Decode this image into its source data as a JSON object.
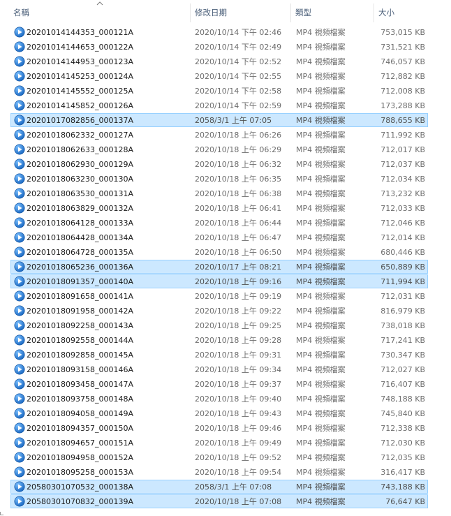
{
  "columns": {
    "name": "名稱",
    "modified": "修改日期",
    "type": "類型",
    "size": "大小"
  },
  "sort": {
    "column": "name",
    "direction": "ascending",
    "icon": "sort-up-chevron-icon"
  },
  "file_icon": "media-play-icon",
  "colors": {
    "selection_fill": "#cce8ff",
    "selection_border": "#99d1ff",
    "icon_blue": "#2f7fd6"
  },
  "files": [
    {
      "name": "20201014144353_000121A",
      "modified": "2020/10/14 下午 02:46",
      "type": "MP4 視頻檔案",
      "size": "753,015 KB",
      "selected": false
    },
    {
      "name": "20201014144653_000122A",
      "modified": "2020/10/14 下午 02:49",
      "type": "MP4 視頻檔案",
      "size": "731,521 KB",
      "selected": false
    },
    {
      "name": "20201014144953_000123A",
      "modified": "2020/10/14 下午 02:52",
      "type": "MP4 視頻檔案",
      "size": "746,057 KB",
      "selected": false
    },
    {
      "name": "20201014145253_000124A",
      "modified": "2020/10/14 下午 02:55",
      "type": "MP4 視頻檔案",
      "size": "712,882 KB",
      "selected": false
    },
    {
      "name": "20201014145552_000125A",
      "modified": "2020/10/14 下午 02:58",
      "type": "MP4 視頻檔案",
      "size": "712,008 KB",
      "selected": false
    },
    {
      "name": "20201014145852_000126A",
      "modified": "2020/10/14 下午 02:59",
      "type": "MP4 視頻檔案",
      "size": "173,288 KB",
      "selected": false
    },
    {
      "name": "20201017082856_000137A",
      "modified": "2058/3/1 上午 07:05",
      "type": "MP4 視頻檔案",
      "size": "788,655 KB",
      "selected": true
    },
    {
      "name": "20201018062332_000127A",
      "modified": "2020/10/18 上午 06:26",
      "type": "MP4 視頻檔案",
      "size": "711,992 KB",
      "selected": false
    },
    {
      "name": "20201018062633_000128A",
      "modified": "2020/10/18 上午 06:29",
      "type": "MP4 視頻檔案",
      "size": "712,017 KB",
      "selected": false
    },
    {
      "name": "20201018062930_000129A",
      "modified": "2020/10/18 上午 06:32",
      "type": "MP4 視頻檔案",
      "size": "712,037 KB",
      "selected": false
    },
    {
      "name": "20201018063230_000130A",
      "modified": "2020/10/18 上午 06:35",
      "type": "MP4 視頻檔案",
      "size": "712,034 KB",
      "selected": false
    },
    {
      "name": "20201018063530_000131A",
      "modified": "2020/10/18 上午 06:38",
      "type": "MP4 視頻檔案",
      "size": "713,232 KB",
      "selected": false
    },
    {
      "name": "20201018063829_000132A",
      "modified": "2020/10/18 上午 06:41",
      "type": "MP4 視頻檔案",
      "size": "712,033 KB",
      "selected": false
    },
    {
      "name": "20201018064128_000133A",
      "modified": "2020/10/18 上午 06:44",
      "type": "MP4 視頻檔案",
      "size": "712,046 KB",
      "selected": false
    },
    {
      "name": "20201018064428_000134A",
      "modified": "2020/10/18 上午 06:47",
      "type": "MP4 視頻檔案",
      "size": "712,014 KB",
      "selected": false
    },
    {
      "name": "20201018064728_000135A",
      "modified": "2020/10/18 上午 06:50",
      "type": "MP4 視頻檔案",
      "size": "680,446 KB",
      "selected": false
    },
    {
      "name": "20201018065236_000136A",
      "modified": "2020/10/17 上午 08:21",
      "type": "MP4 視頻檔案",
      "size": "650,889 KB",
      "selected": true
    },
    {
      "name": "20201018091357_000140A",
      "modified": "2020/10/18 上午 09:16",
      "type": "MP4 視頻檔案",
      "size": "711,994 KB",
      "selected": true
    },
    {
      "name": "20201018091658_000141A",
      "modified": "2020/10/18 上午 09:19",
      "type": "MP4 視頻檔案",
      "size": "712,031 KB",
      "selected": false
    },
    {
      "name": "20201018091958_000142A",
      "modified": "2020/10/18 上午 09:22",
      "type": "MP4 視頻檔案",
      "size": "816,979 KB",
      "selected": false
    },
    {
      "name": "20201018092258_000143A",
      "modified": "2020/10/18 上午 09:25",
      "type": "MP4 視頻檔案",
      "size": "738,018 KB",
      "selected": false
    },
    {
      "name": "20201018092558_000144A",
      "modified": "2020/10/18 上午 09:28",
      "type": "MP4 視頻檔案",
      "size": "717,241 KB",
      "selected": false
    },
    {
      "name": "20201018092858_000145A",
      "modified": "2020/10/18 上午 09:31",
      "type": "MP4 視頻檔案",
      "size": "730,347 KB",
      "selected": false
    },
    {
      "name": "20201018093158_000146A",
      "modified": "2020/10/18 上午 09:34",
      "type": "MP4 視頻檔案",
      "size": "712,027 KB",
      "selected": false
    },
    {
      "name": "20201018093458_000147A",
      "modified": "2020/10/18 上午 09:37",
      "type": "MP4 視頻檔案",
      "size": "716,407 KB",
      "selected": false
    },
    {
      "name": "20201018093758_000148A",
      "modified": "2020/10/18 上午 09:40",
      "type": "MP4 視頻檔案",
      "size": "748,188 KB",
      "selected": false
    },
    {
      "name": "20201018094058_000149A",
      "modified": "2020/10/18 上午 09:43",
      "type": "MP4 視頻檔案",
      "size": "745,840 KB",
      "selected": false
    },
    {
      "name": "20201018094357_000150A",
      "modified": "2020/10/18 上午 09:46",
      "type": "MP4 視頻檔案",
      "size": "712,338 KB",
      "selected": false
    },
    {
      "name": "20201018094657_000151A",
      "modified": "2020/10/18 上午 09:49",
      "type": "MP4 視頻檔案",
      "size": "712,030 KB",
      "selected": false
    },
    {
      "name": "20201018094958_000152A",
      "modified": "2020/10/18 上午 09:52",
      "type": "MP4 視頻檔案",
      "size": "712,035 KB",
      "selected": false
    },
    {
      "name": "20201018095258_000153A",
      "modified": "2020/10/18 上午 09:54",
      "type": "MP4 視頻檔案",
      "size": "316,417 KB",
      "selected": false
    },
    {
      "name": "20580301070532_000138A",
      "modified": "2058/3/1 上午 07:08",
      "type": "MP4 視頻檔案",
      "size": "743,188 KB",
      "selected": true
    },
    {
      "name": "20580301070832_000139A",
      "modified": "2020/10/18 上午 07:08",
      "type": "MP4 視頻檔案",
      "size": "76,647 KB",
      "selected": true
    }
  ]
}
